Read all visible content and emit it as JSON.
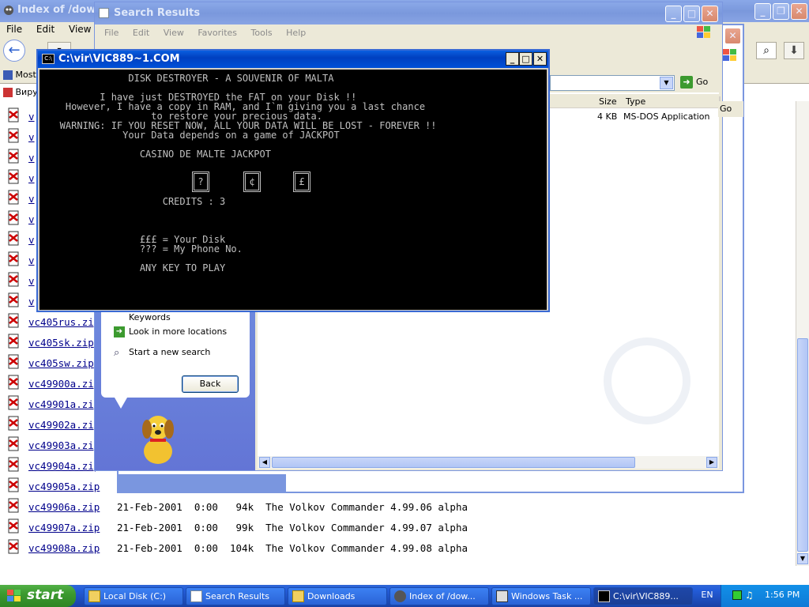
{
  "browser": {
    "title": "Index of /down",
    "menu": [
      "File",
      "Edit",
      "View",
      "H"
    ],
    "links": [
      "Most",
      "Виру"
    ],
    "files": [
      {
        "name": "v",
        "meta": ""
      },
      {
        "name": "v",
        "meta": ""
      },
      {
        "name": "v",
        "meta": ""
      },
      {
        "name": "v",
        "meta": ""
      },
      {
        "name": "v",
        "meta": ""
      },
      {
        "name": "v",
        "meta": ""
      },
      {
        "name": "v",
        "meta": ""
      },
      {
        "name": "v",
        "meta": ""
      },
      {
        "name": "v",
        "meta": ""
      },
      {
        "name": "v",
        "meta": ""
      },
      {
        "name": "vc405rus.zip",
        "meta": ""
      },
      {
        "name": "vc405sk.zip",
        "meta": ""
      },
      {
        "name": "vc405sw.zip",
        "meta": ""
      },
      {
        "name": "vc49900a.zip",
        "meta": ""
      },
      {
        "name": "vc49901a.zip",
        "meta": ""
      },
      {
        "name": "vc49902a.zip",
        "meta": ""
      },
      {
        "name": "vc49903a.zip",
        "meta": ""
      },
      {
        "name": "vc49904a.zip",
        "meta": ""
      },
      {
        "name": "vc49905a.zip",
        "meta": ""
      },
      {
        "name": "vc49906a.zip",
        "meta": "21-Feb-2001  0:00   94k  The Volkov Commander 4.99.06 alpha"
      },
      {
        "name": "vc49907a.zip",
        "meta": "21-Feb-2001  0:00   99k  The Volkov Commander 4.99.07 alpha"
      },
      {
        "name": "vc49908a.zip",
        "meta": "21-Feb-2001  0:00  104k  The Volkov Commander 4.99.08 alpha"
      }
    ]
  },
  "search": {
    "title": "Search Results",
    "menu": [
      "File",
      "Edit",
      "View",
      "Favorites",
      "Tools",
      "Help"
    ],
    "go_label": "Go",
    "columns": [
      "Size",
      "Type"
    ],
    "go_col": "Go",
    "result": {
      "size": "4 KB",
      "type": "MS-DOS Application"
    },
    "links": [
      "Keywords",
      "Look in more locations",
      "Start a new search"
    ],
    "back_label": "Back"
  },
  "dos": {
    "title": "C:\\vir\\VIC889~1.COM",
    "lines": [
      "               DISK DESTROYER - A SOUVENIR OF MALTA",
      "",
      "          I have just DESTROYED the FAT on your Disk !!",
      "    However, I have a copy in RAM, and I`m giving you a last chance",
      "                   to restore your precious data.",
      "   WARNING: IF YOU RESET NOW, ALL YOUR DATA WILL BE LOST - FOREVER !!",
      "              Your Data depends on a game of JACKPOT",
      "",
      "                 CASINO DE MALTE JACKPOT",
      "",
      "",
      "",
      "",
      "                     CREDITS : 3",
      "",
      "",
      "",
      "                 £££ = Your Disk",
      "                 ??? = My Phone No.",
      "",
      "                 ANY KEY TO PLAY"
    ],
    "reels": [
      "?",
      "¢",
      "£"
    ]
  },
  "taskbar": {
    "start": "start",
    "items": [
      "Local Disk (C:)",
      "Search Results",
      "Downloads",
      "Index of /dow...",
      "Windows Task ...",
      "C:\\vir\\VIC889..."
    ],
    "lang": "EN",
    "clock": "1:56 PM"
  },
  "colors": {
    "xp_blue": "#0a5fe0",
    "start_green": "#3c9a2f",
    "console_bg": "#000000",
    "link": "#00008b"
  }
}
